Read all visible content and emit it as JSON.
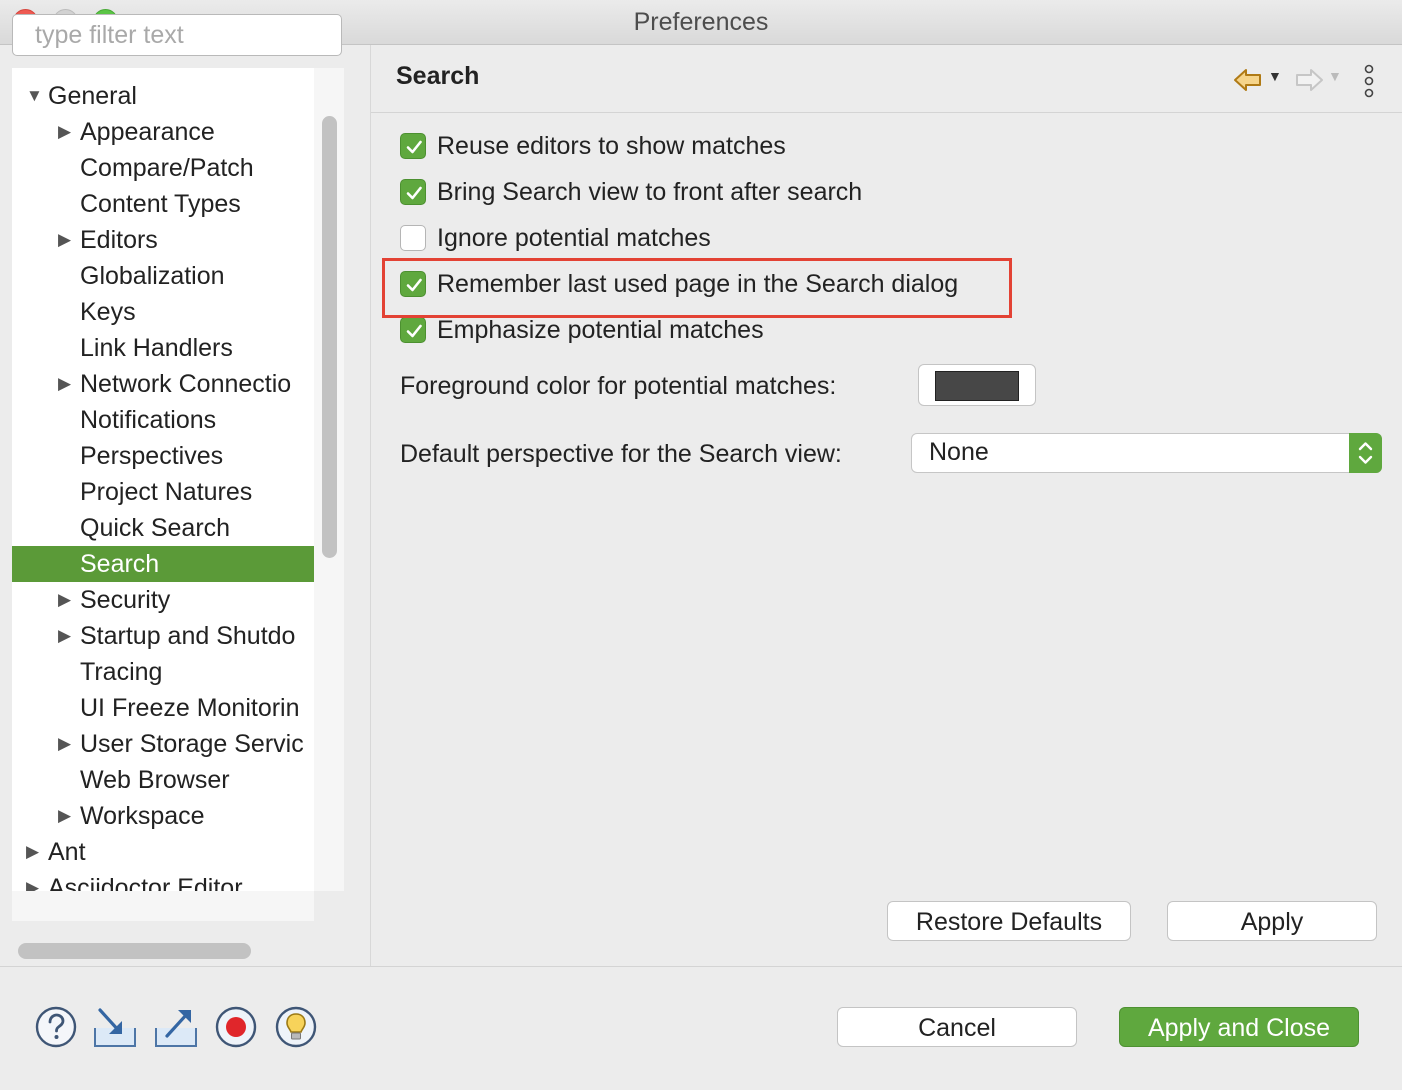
{
  "window": {
    "title": "Preferences"
  },
  "filter": {
    "placeholder": "type filter text",
    "value": ""
  },
  "tree": [
    {
      "label": "General",
      "expanded": true,
      "level": 0
    },
    {
      "label": "Appearance",
      "expandable": true,
      "level": 1
    },
    {
      "label": "Compare/Patch",
      "level": 1
    },
    {
      "label": "Content Types",
      "level": 1
    },
    {
      "label": "Editors",
      "expandable": true,
      "level": 1
    },
    {
      "label": "Globalization",
      "level": 1
    },
    {
      "label": "Keys",
      "level": 1
    },
    {
      "label": "Link Handlers",
      "level": 1
    },
    {
      "label": "Network Connectio",
      "expandable": true,
      "level": 1
    },
    {
      "label": "Notifications",
      "level": 1
    },
    {
      "label": "Perspectives",
      "level": 1
    },
    {
      "label": "Project Natures",
      "level": 1
    },
    {
      "label": "Quick Search",
      "level": 1
    },
    {
      "label": "Search",
      "level": 1,
      "selected": true
    },
    {
      "label": "Security",
      "expandable": true,
      "level": 1
    },
    {
      "label": "Startup and Shutdo",
      "expandable": true,
      "level": 1
    },
    {
      "label": "Tracing",
      "level": 1
    },
    {
      "label": "UI Freeze Monitorin",
      "level": 1
    },
    {
      "label": "User Storage Servic",
      "expandable": true,
      "level": 1
    },
    {
      "label": "Web Browser",
      "level": 1
    },
    {
      "label": "Workspace",
      "expandable": true,
      "level": 1
    },
    {
      "label": "Ant",
      "expandable": true,
      "level": 0
    },
    {
      "label": "Asciidoctor Editor",
      "expandable": true,
      "level": 0
    }
  ],
  "page": {
    "title": "Search"
  },
  "options": [
    {
      "label": "Reuse editors to show matches",
      "checked": true
    },
    {
      "label": "Bring Search view to front after search",
      "checked": true
    },
    {
      "label": "Ignore potential matches",
      "checked": false
    },
    {
      "label": "Remember last used page in the Search dialog",
      "checked": true
    },
    {
      "label": "Emphasize potential matches",
      "checked": true
    }
  ],
  "foreground": {
    "label": "Foreground color for potential matches:",
    "color": "#474747"
  },
  "perspective": {
    "label": "Default perspective for the Search view:",
    "value": "None"
  },
  "buttons": {
    "restore_defaults": "Restore Defaults",
    "apply": "Apply",
    "cancel": "Cancel",
    "apply_and_close": "Apply and Close"
  },
  "colors": {
    "accent": "#5fa83e",
    "selection": "#5b9a38",
    "highlight_box": "#e34234"
  },
  "icons": [
    "help-icon",
    "import-icon",
    "export-icon",
    "record-icon",
    "lightbulb-icon",
    "back-arrow-icon",
    "forward-arrow-icon",
    "view-menu-icon"
  ]
}
